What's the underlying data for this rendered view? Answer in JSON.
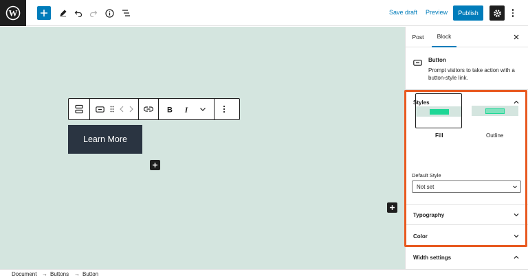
{
  "topbar": {
    "save_draft": "Save draft",
    "preview": "Preview",
    "publish": "Publish",
    "icons": [
      "wordpress-logo-icon",
      "plus-icon",
      "pencil-icon",
      "undo-icon",
      "redo-icon",
      "info-icon",
      "list-view-icon",
      "gear-icon",
      "more-vertical-icon"
    ]
  },
  "canvas": {
    "background": "#d4e5df",
    "button_label": "Learn More"
  },
  "sidebar": {
    "tabs": [
      {
        "label": "Post"
      },
      {
        "label": "Block"
      }
    ],
    "block_card": {
      "title": "Button",
      "description": "Prompt visitors to take action with a button-style link."
    },
    "styles_panel": {
      "title": "Styles",
      "options": [
        {
          "label": "Fill"
        },
        {
          "label": "Outline"
        }
      ],
      "default_style_label": "Default Style",
      "default_style_value": "Not set"
    },
    "panels": [
      {
        "title": "Typography"
      },
      {
        "title": "Color"
      },
      {
        "title": "Width settings"
      }
    ]
  },
  "breadcrumb": {
    "items": [
      "Document",
      "Buttons",
      "Button"
    ],
    "separator": "→"
  },
  "colors": {
    "accent": "#007cba",
    "highlight": "#e85a21",
    "button_dark": "#2a3441",
    "thumb_green": "#1ed796"
  }
}
